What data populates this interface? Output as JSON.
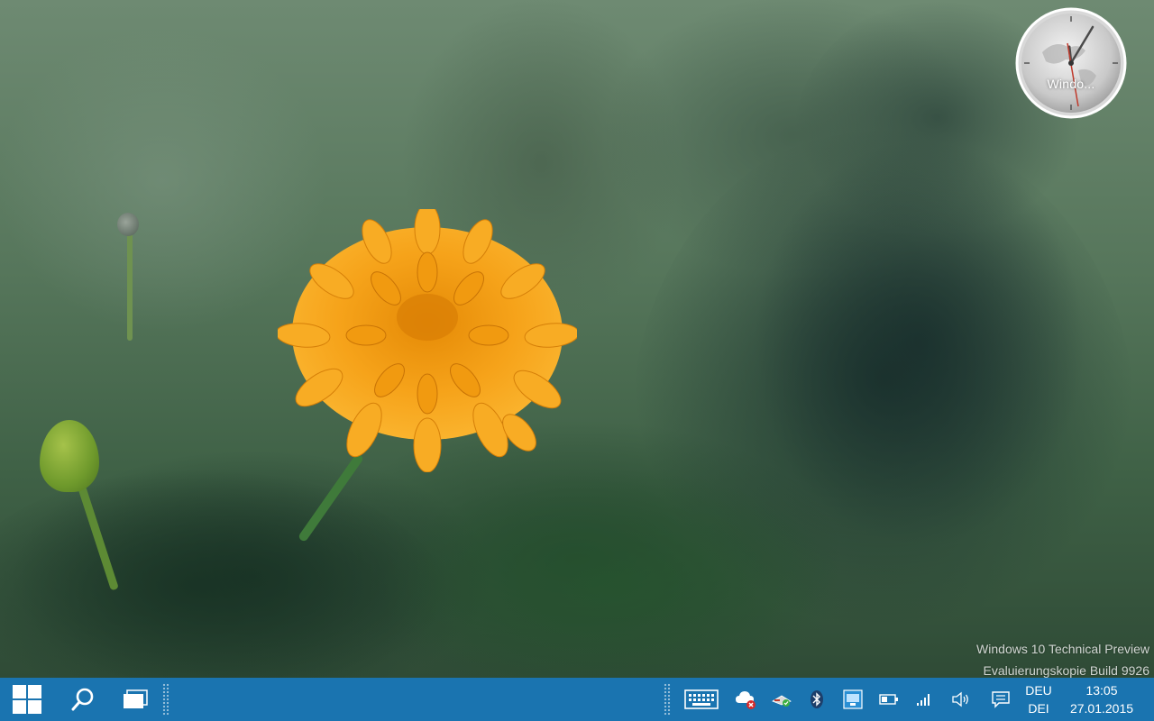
{
  "desktop": {
    "wallpaper": "marigold-flower-wallpaper",
    "watermark": {
      "line1": "Windows 10 Technical Preview",
      "line2": "Evaluierungskopie Build 9926"
    }
  },
  "gadget": {
    "clock_label": "Windo..."
  },
  "taskbar": {
    "color": "#1a74b0",
    "start_icon": "windows-logo-icon",
    "search_icon": "search-icon",
    "task_view_icon": "task-view-icon",
    "tray": {
      "icons": [
        "touch-keyboard-icon",
        "cloud-sync-error-icon",
        "network-adapter-icon",
        "bluetooth-icon",
        "display-settings-icon",
        "battery-icon",
        "signal-strength-icon",
        "volume-icon",
        "action-center-icon"
      ],
      "language_top": "DEU",
      "language_bottom": "DEI",
      "time": "13:05",
      "date": "27.01.2015"
    }
  }
}
